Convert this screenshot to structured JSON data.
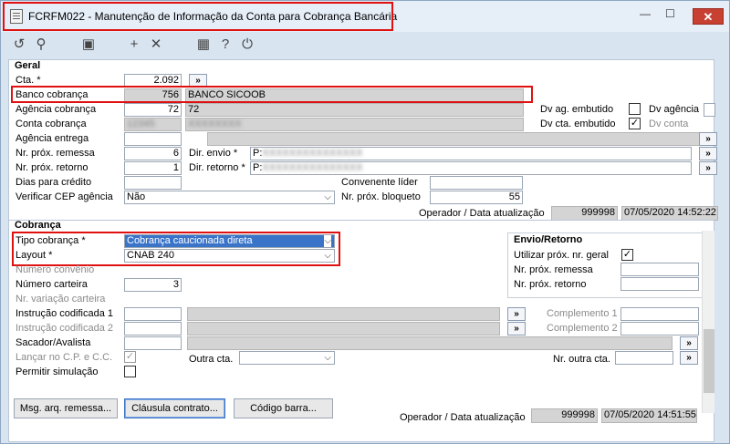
{
  "window": {
    "title": "FCRFM022 - Manutenção de Informação da Conta para Cobrança Bancária",
    "min": "—",
    "max": "☐",
    "close": "✕"
  },
  "toolbar": [
    "undo-icon",
    "search-icon",
    "save-icon",
    "add-icon",
    "delete-icon",
    "calendar-icon",
    "help-icon",
    "power-icon"
  ],
  "geral": {
    "title": "Geral",
    "cta_label": "Cta. *",
    "cta_value": "2.092",
    "banco_label": "Banco cobrança",
    "banco_code": "756",
    "banco_name": "BANCO SICOOB",
    "agencia_label": "Agência cobrança",
    "agencia_code": "72",
    "agencia_name": "72",
    "conta_label": "Conta cobrança",
    "agencia_entrega_label": "Agência entrega",
    "remessa_label": "Nr. próx. remessa",
    "remessa_value": "6",
    "retorno_label": "Nr. próx. retorno",
    "retorno_value": "1",
    "dias_label": "Dias para crédito",
    "cep_label": "Verificar CEP agência",
    "cep_value": "Não",
    "dir_envio_label": "Dir. envio *",
    "dir_envio_value": "P:",
    "dir_retorno_label": "Dir. retorno *",
    "dir_retorno_value": "P:",
    "convenente_label": "Convenente líder",
    "bloqueto_label": "Nr. próx. bloqueto",
    "bloqueto_value": "55",
    "dv_ag_emb": "Dv ag. embutido",
    "dv_agencia": "Dv agência",
    "dv_cta_emb": "Dv cta. embutido",
    "dv_conta": "Dv conta",
    "operador_label": "Operador / Data atualização",
    "operador": "999998",
    "data": "07/05/2020 14:52:22"
  },
  "cobranca": {
    "title": "Cobrança",
    "tipo_label": "Tipo cobrança *",
    "tipo_value": "Cobrança caucionada direta",
    "layout_label": "Layout *",
    "layout_value": "CNAB 240",
    "convenio_label": "Número convênio",
    "carteira_label": "Número carteira",
    "carteira_value": "3",
    "variacao_label": "Nr. variação carteira",
    "instr1_label": "Instrução codificada 1",
    "instr2_label": "Instrução codificada 2",
    "sacador_label": "Sacador/Avalista",
    "lancar_label": "Lançar no C.P. e C.C.",
    "permitir_label": "Permitir simulação",
    "outra_cta_label": "Outra cta.",
    "nr_outra_cta_label": "Nr. outra cta.",
    "complemento1": "Complemento 1",
    "complemento2": "Complemento 2",
    "envio_title": "Envio/Retorno",
    "utilizar_label": "Utilizar próx. nr. geral",
    "env_remessa_label": "Nr. próx. remessa",
    "env_retorno_label": "Nr. próx. retorno",
    "operador_label": "Operador / Data atualização",
    "operador": "999998",
    "data": "07/05/2020 14:51:55"
  },
  "buttons": {
    "msg": "Msg. arq. remessa...",
    "clausula": "Cláusula contrato...",
    "codigo": "Código barra..."
  },
  "glyphs": {
    "more": "»",
    "check": "✓",
    "caret": "⌵"
  }
}
